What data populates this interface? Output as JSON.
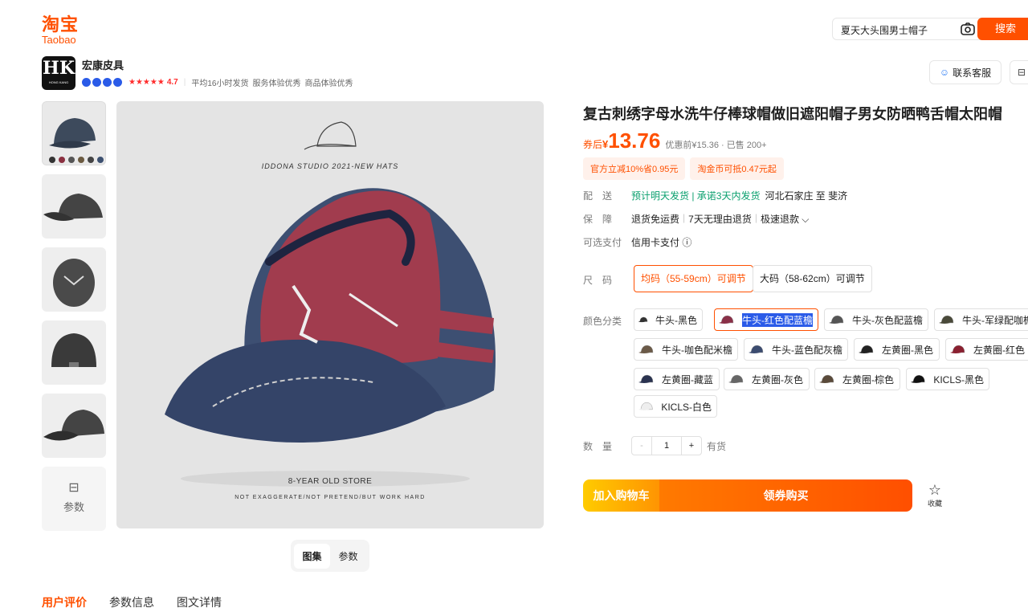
{
  "header": {
    "logo_cn": "淘宝",
    "logo_en": "Taobao",
    "search_value": "夏天大头围男士帽子",
    "search_button": "搜索"
  },
  "shop": {
    "logo_text": "HK",
    "logo_sub": "HONG KANG",
    "name": "宏康皮具",
    "stars": "★★★★★",
    "rating": "4.7",
    "meta": [
      "平均16小时发货",
      "服务体验优秀",
      "商品体验优秀"
    ],
    "service_button": "联系客服"
  },
  "gallery": {
    "param_label": "参数",
    "image_title": "IDDONA STUDIO 2021-NEW HATS",
    "image_sub1": "8-YEAR OLD STORE",
    "image_sub2": "NOT EXAGGERATE/NOT PRETEND/BUT WORK HARD",
    "tabs": [
      "图集",
      "参数"
    ]
  },
  "bottom_tabs": [
    "用户评价",
    "参数信息",
    "图文详情"
  ],
  "product": {
    "title": "复古刺绣字母水洗牛仔棒球帽做旧遮阳帽子男女防晒鸭舌帽太阳帽",
    "price_label": "券后",
    "price_yen": "¥",
    "price": "13.76",
    "price_note": "优惠前¥15.36 · 已售 200+",
    "coupons": [
      "官方立减10%省0.95元",
      "淘金币可抵0.47元起"
    ],
    "delivery_label": "配　送",
    "delivery_promise": "预计明天发货 | 承诺3天内发货",
    "delivery_route": "河北石家庄 至 斐济",
    "guarantee_label": "保　障",
    "guarantees": [
      "退货免运费",
      "7天无理由退货",
      "极速退款 ⌵"
    ],
    "payment_label": "可选支付",
    "payment_value": "信用卡支付 ⓘ",
    "size_label": "尺　码",
    "sizes": [
      "均码（55-59cm）可调节",
      "大码（58-62cm）可调节"
    ],
    "color_label": "颜色分类",
    "colors": [
      "牛头-黑色",
      "牛头-红色配蓝檐",
      "牛头-灰色配蓝檐",
      "牛头-军绿配咖檐",
      "牛头-咖色配米檐",
      "牛头-蓝色配灰檐",
      "左黄圈-黑色",
      "左黄圈-红色",
      "左黄圈-藏蓝",
      "左黄圈-灰色",
      "左黄圈-棕色",
      "KICLS-黑色",
      "KICLS-白色"
    ],
    "qty_label": "数　量",
    "qty_minus": "-",
    "qty_value": "1",
    "qty_plus": "+",
    "stock": "有货",
    "cart_button": "加入购物车",
    "buy_button": "领券购买",
    "favorite": "收藏"
  }
}
